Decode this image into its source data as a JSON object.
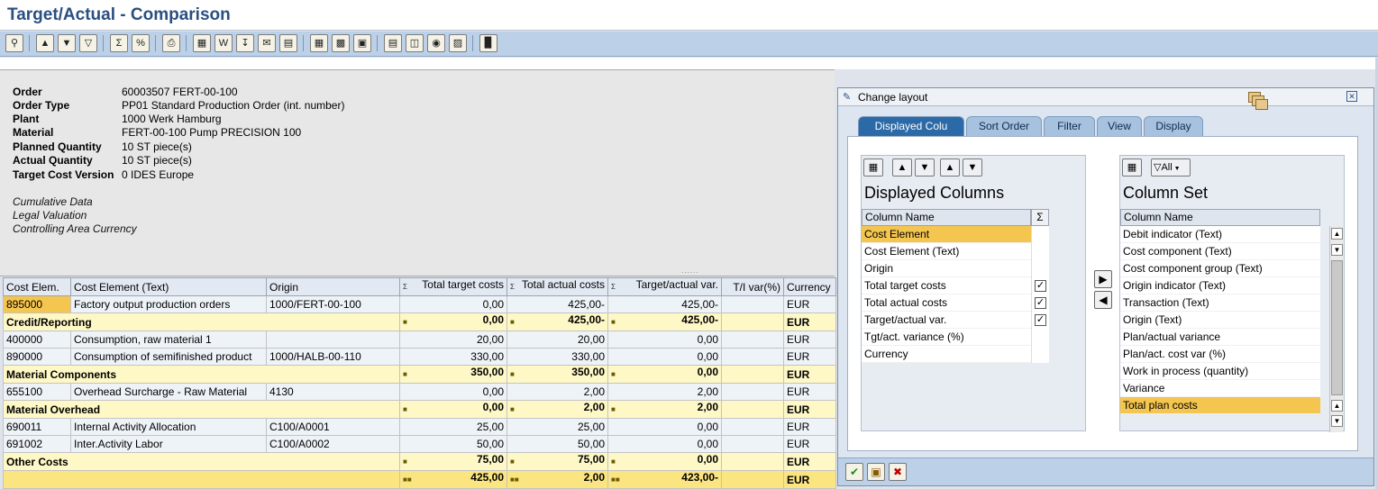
{
  "window": {
    "title": "Target/Actual - Comparison"
  },
  "toolbar": {
    "icons": [
      "detail-icon",
      "select-icon",
      "set-filter-icon",
      "filter-icon",
      "total-icon",
      "subtotal-icon",
      "print-preview-icon",
      "export-spreadsheet-icon",
      "export-word-icon",
      "export-local-file-icon",
      "send-icon",
      "abc-analysis-icon",
      "graphic-icon",
      "change-layout-icon",
      "select-layout-icon",
      "save-layout-icon",
      "information-icon",
      "hierarchy-icon",
      "drilldown-icon",
      "currency-icon",
      "cost-element-icon"
    ]
  },
  "header": {
    "fields": [
      {
        "label": "Order",
        "value": "60003507 FERT-00-100"
      },
      {
        "label": "Order Type",
        "value": "PP01 Standard Production Order (int. number)"
      },
      {
        "label": "Plant",
        "value": "1000 Werk Hamburg"
      },
      {
        "label": "Material",
        "value": "FERT-00-100 Pump PRECISION 100"
      },
      {
        "label": "Planned Quantity",
        "value": "10 ST piece(s)"
      },
      {
        "label": "Actual Quantity",
        "value": "10 ST piece(s)"
      },
      {
        "label": "Target Cost Version",
        "value": "0 IDES Europe"
      }
    ],
    "notes": [
      "Cumulative Data",
      "Legal Valuation",
      "Controlling Area Currency"
    ]
  },
  "grid": {
    "columns": [
      "Cost Elem.",
      "Cost Element (Text)",
      "Origin",
      "Total target costs",
      "Total actual costs",
      "Target/actual var.",
      "T/I var(%)",
      "Currency"
    ],
    "rows": [
      {
        "type": "data",
        "c0": "895000",
        "c1": "Factory output production orders",
        "c2": "1000/FERT-00-100",
        "c3": "0,00",
        "c4": "425,00-",
        "c5": "425,00-",
        "c6": "",
        "c7": "EUR"
      },
      {
        "type": "sub",
        "c0": "Credit/Reporting",
        "c1": "",
        "c2": "",
        "c3": "0,00",
        "c4": "425,00-",
        "c5": "425,00-",
        "c6": "",
        "c7": "EUR"
      },
      {
        "type": "data",
        "c0": "400000",
        "c1": "Consumption, raw material 1",
        "c2": "",
        "c3": "20,00",
        "c4": "20,00",
        "c5": "0,00",
        "c6": "",
        "c7": "EUR"
      },
      {
        "type": "data",
        "c0": "890000",
        "c1": "Consumption of semifinished product",
        "c2": "1000/HALB-00-110",
        "c3": "330,00",
        "c4": "330,00",
        "c5": "0,00",
        "c6": "",
        "c7": "EUR"
      },
      {
        "type": "sub",
        "c0": "Material Components",
        "c1": "",
        "c2": "",
        "c3": "350,00",
        "c4": "350,00",
        "c5": "0,00",
        "c6": "",
        "c7": "EUR"
      },
      {
        "type": "data",
        "c0": "655100",
        "c1": "Overhead Surcharge - Raw Material",
        "c2": "4130",
        "c3": "0,00",
        "c4": "2,00",
        "c5": "2,00",
        "c6": "",
        "c7": "EUR"
      },
      {
        "type": "sub",
        "c0": "Material Overhead",
        "c1": "",
        "c2": "",
        "c3": "0,00",
        "c4": "2,00",
        "c5": "2,00",
        "c6": "",
        "c7": "EUR"
      },
      {
        "type": "data",
        "c0": "690011",
        "c1": "Internal Activity Allocation",
        "c2": "C100/A0001",
        "c3": "25,00",
        "c4": "25,00",
        "c5": "0,00",
        "c6": "",
        "c7": "EUR"
      },
      {
        "type": "data",
        "c0": "691002",
        "c1": "Inter.Activity Labor",
        "c2": "C100/A0002",
        "c3": "50,00",
        "c4": "50,00",
        "c5": "0,00",
        "c6": "",
        "c7": "EUR"
      },
      {
        "type": "sub",
        "c0": "Other Costs",
        "c1": "",
        "c2": "",
        "c3": "75,00",
        "c4": "75,00",
        "c5": "0,00",
        "c6": "",
        "c7": "EUR"
      },
      {
        "type": "total",
        "c0": "",
        "c1": "",
        "c2": "",
        "c3": "425,00",
        "c4": "2,00",
        "c5": "423,00-",
        "c6": "",
        "c7": "EUR"
      }
    ]
  },
  "dialog": {
    "title": "Change layout",
    "tabs": [
      "Displayed Colu",
      "Sort Order",
      "Filter",
      "View",
      "Display"
    ],
    "left": {
      "title": "Displayed Columns",
      "column_header": "Column Name",
      "items": [
        "Cost Element",
        "Cost Element (Text)",
        "Origin",
        "Total target costs",
        "Total actual costs",
        "Target/actual var.",
        "Tgt/act. variance (%)",
        "Currency"
      ],
      "selected_index": 0,
      "checked": [
        false,
        false,
        false,
        true,
        true,
        true,
        false,
        false
      ]
    },
    "right": {
      "title": "Column Set",
      "column_header": "Column Name",
      "filter_label": "All",
      "items": [
        "Debit indicator (Text)",
        "Cost component (Text)",
        "Cost component group (Text)",
        "Origin indicator (Text)",
        "Transaction (Text)",
        "Origin (Text)",
        "Plan/actual variance",
        "Plan/act. cost var (%)",
        "Work in process (quantity)",
        "Variance",
        "Total plan costs"
      ],
      "selected_index": 10
    }
  }
}
